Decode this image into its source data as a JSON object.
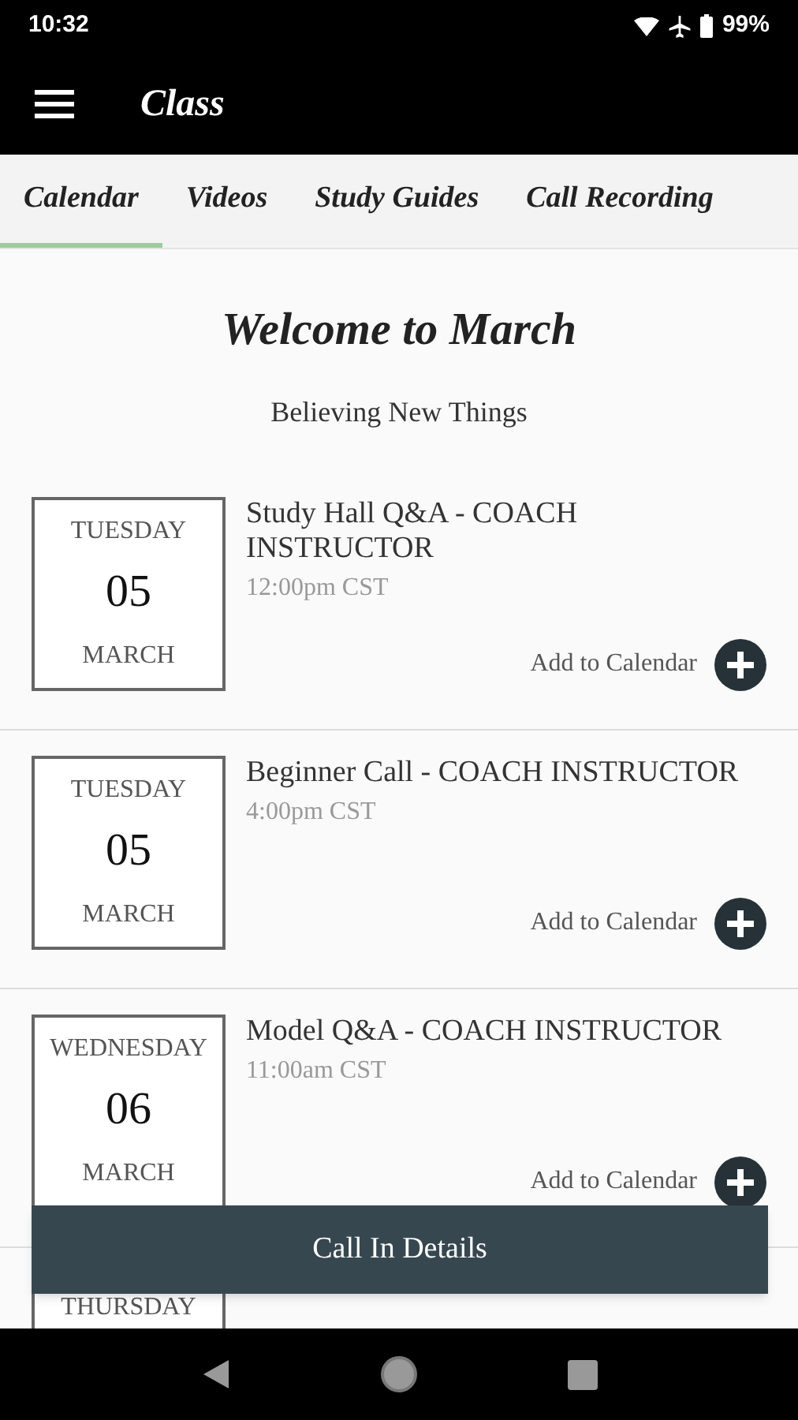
{
  "status_bar": {
    "time": "10:32",
    "battery": "99%"
  },
  "app_bar": {
    "title": "Class"
  },
  "tabs": [
    {
      "label": "Calendar",
      "selected": true
    },
    {
      "label": "Videos",
      "selected": false
    },
    {
      "label": "Study Guides",
      "selected": false
    },
    {
      "label": "Call Recording",
      "selected": false
    }
  ],
  "heading": "Welcome to March",
  "subtitle": "Believing New Things",
  "events": [
    {
      "weekday": "TUESDAY",
      "day": "05",
      "month": "MARCH",
      "title": "Study Hall Q&A - COACH INSTRUCTOR",
      "time": "12:00pm CST",
      "action": "Add to Calendar"
    },
    {
      "weekday": "TUESDAY",
      "day": "05",
      "month": "MARCH",
      "title": "Beginner Call - COACH INSTRUCTOR",
      "time": "4:00pm CST",
      "action": "Add to Calendar"
    },
    {
      "weekday": "WEDNESDAY",
      "day": "06",
      "month": "MARCH",
      "title": "Model Q&A - COACH INSTRUCTOR",
      "time": "11:00am CST",
      "action": "Add to Calendar"
    },
    {
      "weekday": "THURSDAY"
    }
  ],
  "call_in_button": "Call In Details"
}
